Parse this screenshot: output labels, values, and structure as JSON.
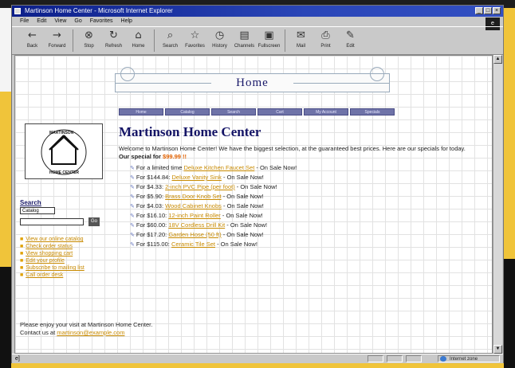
{
  "window": {
    "title": "Martinson Home Center - Microsoft Internet Explorer",
    "controls": {
      "minimize": "_",
      "maximize": "□",
      "close": "×"
    }
  },
  "menu": [
    "File",
    "Edit",
    "View",
    "Go",
    "Favorites",
    "Help"
  ],
  "throbber_label": "e",
  "toolbar": [
    {
      "icon": "back-arrow-icon",
      "glyph": "←",
      "label": "Back"
    },
    {
      "icon": "forward-arrow-icon",
      "glyph": "→",
      "label": "Forward"
    },
    {
      "icon": "stop-icon",
      "glyph": "⊗",
      "label": "Stop"
    },
    {
      "icon": "refresh-icon",
      "glyph": "↻",
      "label": "Refresh"
    },
    {
      "icon": "home-icon",
      "glyph": "⌂",
      "label": "Home"
    },
    {
      "icon": "search-icon",
      "glyph": "⌕",
      "label": "Search"
    },
    {
      "icon": "favorites-icon",
      "glyph": "☆",
      "label": "Favorites"
    },
    {
      "icon": "history-icon",
      "glyph": "◷",
      "label": "History"
    },
    {
      "icon": "channels-icon",
      "glyph": "▤",
      "label": "Channels"
    },
    {
      "icon": "fullscreen-icon",
      "glyph": "▣",
      "label": "Fullscreen"
    },
    {
      "icon": "mail-icon",
      "glyph": "✉",
      "label": "Mail"
    },
    {
      "icon": "print-icon",
      "glyph": "⎙",
      "label": "Print"
    },
    {
      "icon": "edit-icon",
      "glyph": "✎",
      "label": "Edit"
    }
  ],
  "banner": {
    "title": "Home"
  },
  "nav": [
    "Home",
    "Catalog",
    "Search",
    "Cart",
    "My Account",
    "Specials"
  ],
  "logo": {
    "top_text": "MARTINSON",
    "bottom_text": "HOME CENTER"
  },
  "search": {
    "label": "Search",
    "select_value": "Catalog",
    "button": "Go"
  },
  "sidebar_links": [
    "View our online catalog",
    "Check order status",
    "View shopping cart",
    "Edit your profile",
    "Subscribe to mailing list",
    "Call order desk"
  ],
  "main": {
    "title": "Martinson Home Center",
    "welcome": "Welcome to Martinson Home Center! We have the biggest selection, at the guaranteed best prices. Here are our specials for today.",
    "special_label": "Our special for",
    "special_price": "$99.99 !!",
    "deals": [
      {
        "price": "For a limited time",
        "link": "Deluxe Kitchen Faucet Set",
        "suffix": " - On Sale Now!"
      },
      {
        "price": "For $144.84:",
        "link": "Deluxe Vanity Sink",
        "suffix": " - On Sale Now!"
      },
      {
        "price": "For $4.33:",
        "link": "2-inch PVC Pipe (per foot)",
        "suffix": " - On Sale Now!"
      },
      {
        "price": "For $5.90:",
        "link": "Brass Door Knob Set",
        "suffix": " - On Sale Now!"
      },
      {
        "price": "For $4.03:",
        "link": "Wood Cabinet Knobs",
        "suffix": " - On Sale Now!"
      },
      {
        "price": "For $16.10:",
        "link": "12-inch Paint Roller",
        "suffix": " - On Sale Now!"
      },
      {
        "price": "For $60.00:",
        "link": "18V Cordless Drill Kit",
        "suffix": " - On Sale Now!"
      },
      {
        "price": "For $17.20:",
        "link": "Garden Hose (50 ft)",
        "suffix": " - On Sale Now!"
      },
      {
        "price": "For $115.00:",
        "link": "Ceramic Tile Set",
        "suffix": " - On Sale Now!"
      }
    ]
  },
  "footer": {
    "line1": "Please enjoy your visit at Martinson Home Center.",
    "contact_prefix": "Contact us at",
    "contact_link": "martinson@example.com"
  },
  "status": {
    "left": "e]",
    "zone": "Internet zone"
  }
}
